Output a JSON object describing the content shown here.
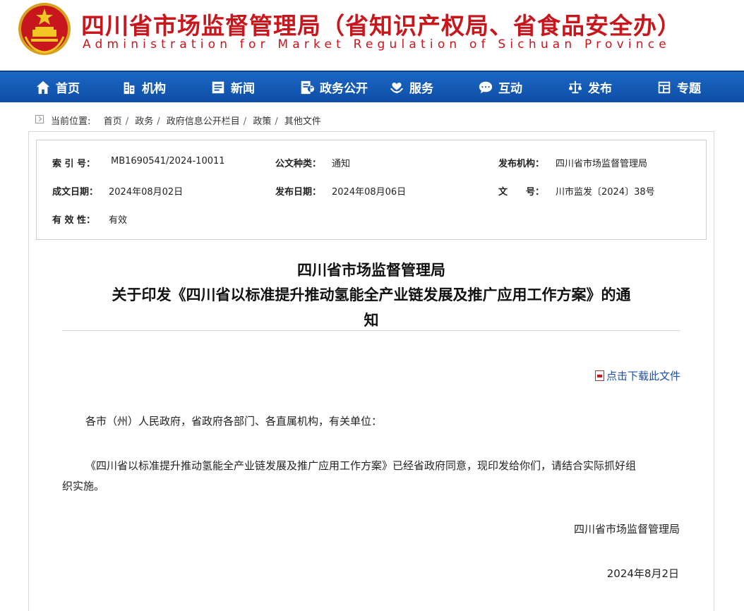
{
  "header": {
    "title_cn": "四川省市场监督管理局（省知识产权局、省食品安全办）",
    "title_en": "Administration for Market Regulation of Sichuan Province"
  },
  "nav": {
    "items": [
      {
        "label": "首页",
        "icon": "home-icon"
      },
      {
        "label": "机构",
        "icon": "building-icon"
      },
      {
        "label": "新闻",
        "icon": "news-icon"
      },
      {
        "label": "政务公开",
        "icon": "gov-affairs-icon"
      },
      {
        "label": "服务",
        "icon": "service-icon"
      },
      {
        "label": "互动",
        "icon": "chat-icon"
      },
      {
        "label": "发布",
        "icon": "scales-icon"
      },
      {
        "label": "专题",
        "icon": "topic-icon"
      }
    ]
  },
  "breadcrumb": {
    "prefix": "当前位置:",
    "items": [
      "首页",
      "政务",
      "政府信息公开栏目",
      "政策",
      "其他文件"
    ]
  },
  "meta": {
    "index_label": "索 引 号：",
    "index_value": "MB1690541/2024-10011",
    "doctype_label": "公文种类：",
    "doctype_value": "通知",
    "publisher_label": "发布机构：",
    "publisher_value": "四川省市场监督管理局",
    "written_label": "成文日期：",
    "written_value": "2024年08月02日",
    "published_label": "发布日期：",
    "published_value": "2024年08月06日",
    "docno_label": "文　　号：",
    "docno_value": "川市监发〔2024〕38号",
    "validity_label": "有 效 性：",
    "validity_value": "有效"
  },
  "document": {
    "title_line1": "四川省市场监督管理局",
    "title_line2": "关于印发《四川省以标准提升推动氢能全产业链发展及推广应用工作方案》的通",
    "title_line3": "知",
    "download_label": "点击下载此文件",
    "salutation": "各市（州）人民政府，省政府各部门、各直属机构，有关单位：",
    "body_line1": "《四川省以标准提升推动氢能全产业链发展及推广应用工作方案》已经省政府同意，现印发给你们，请结合实际抓好组",
    "body_line2": "织实施。",
    "signature": "四川省市场监督管理局",
    "date": "2024年8月2日"
  },
  "colors": {
    "brand_red": "#c8161d",
    "nav_blue": "#1558b5",
    "link_blue": "#1f50a8"
  }
}
